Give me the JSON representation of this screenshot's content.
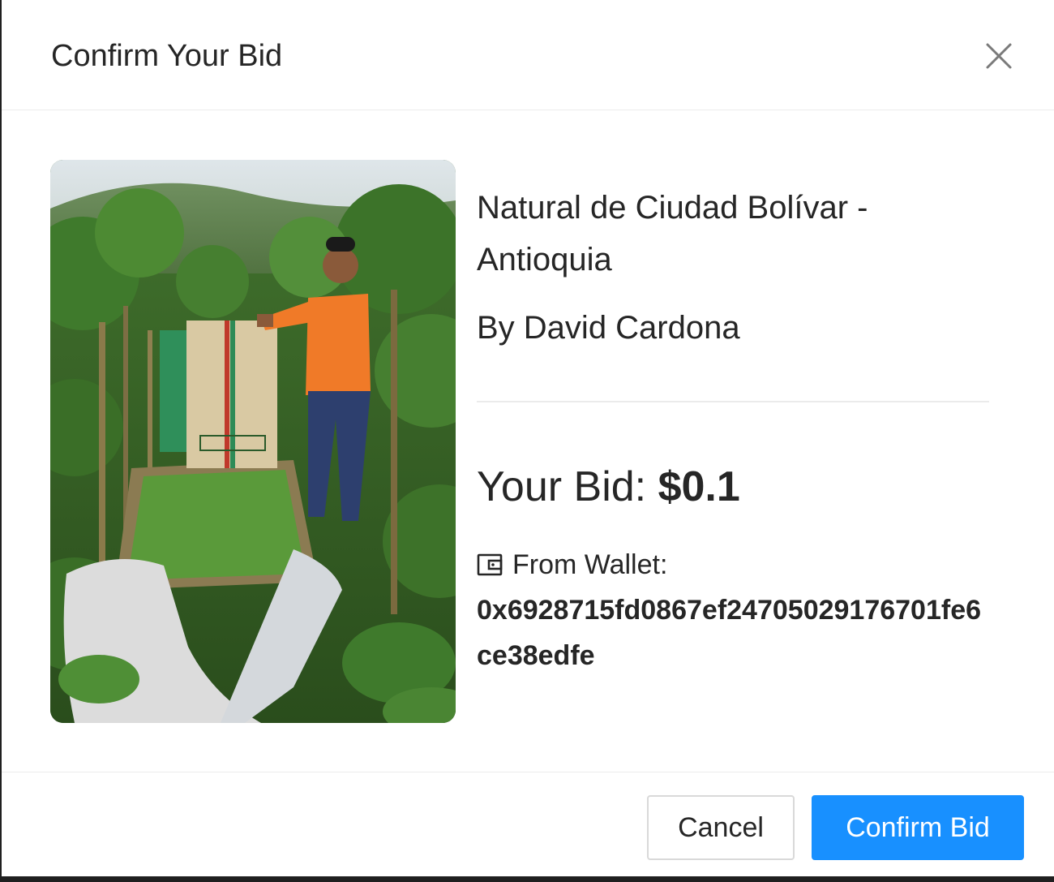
{
  "modal": {
    "title": "Confirm Your Bid",
    "close_icon": "close-icon"
  },
  "product": {
    "name": "Natural de Ciudad Bolívar - Antioquia",
    "producer": "By David Cardona",
    "image_description_icon": "coffee-farmer-photo"
  },
  "bid": {
    "label": "Your Bid:",
    "amount": "$0.1"
  },
  "wallet": {
    "icon": "wallet-icon",
    "label": "From Wallet:",
    "address": "0x6928715fd0867ef24705029176701fe6ce38edfe"
  },
  "footer": {
    "cancel_label": "Cancel",
    "confirm_label": "Confirm Bid"
  },
  "colors": {
    "primary": "#1890ff",
    "text": "#262626",
    "border": "#d9d9d9"
  }
}
